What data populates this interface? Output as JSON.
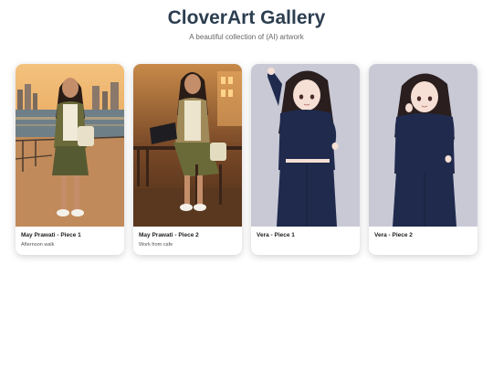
{
  "header": {
    "title": "CloverArt Gallery",
    "subtitle": "A beautiful collection of (AI) artwork"
  },
  "gallery": {
    "items": [
      {
        "title": "May Prawati - Piece 1",
        "description": "Afternoon walk",
        "image": "woman-waterfront-sunset-illustration"
      },
      {
        "title": "May Prawati - Piece 2",
        "description": "Work from cafe",
        "image": "woman-laptop-cafe-illustration"
      },
      {
        "title": "Vera - Piece 1",
        "description": "",
        "image": "anime-girl-navy-outfit-arm-raised"
      },
      {
        "title": "Vera - Piece 2",
        "description": "",
        "image": "anime-girl-navy-outfit-hand-at-face"
      }
    ]
  },
  "colors": {
    "title": "#2c3e50",
    "sunset_sky": "#e8a860",
    "cafe_warm": "#7a4a28",
    "studio_bg": "#c9c9d6",
    "navy_outfit": "#1f2a4d"
  }
}
